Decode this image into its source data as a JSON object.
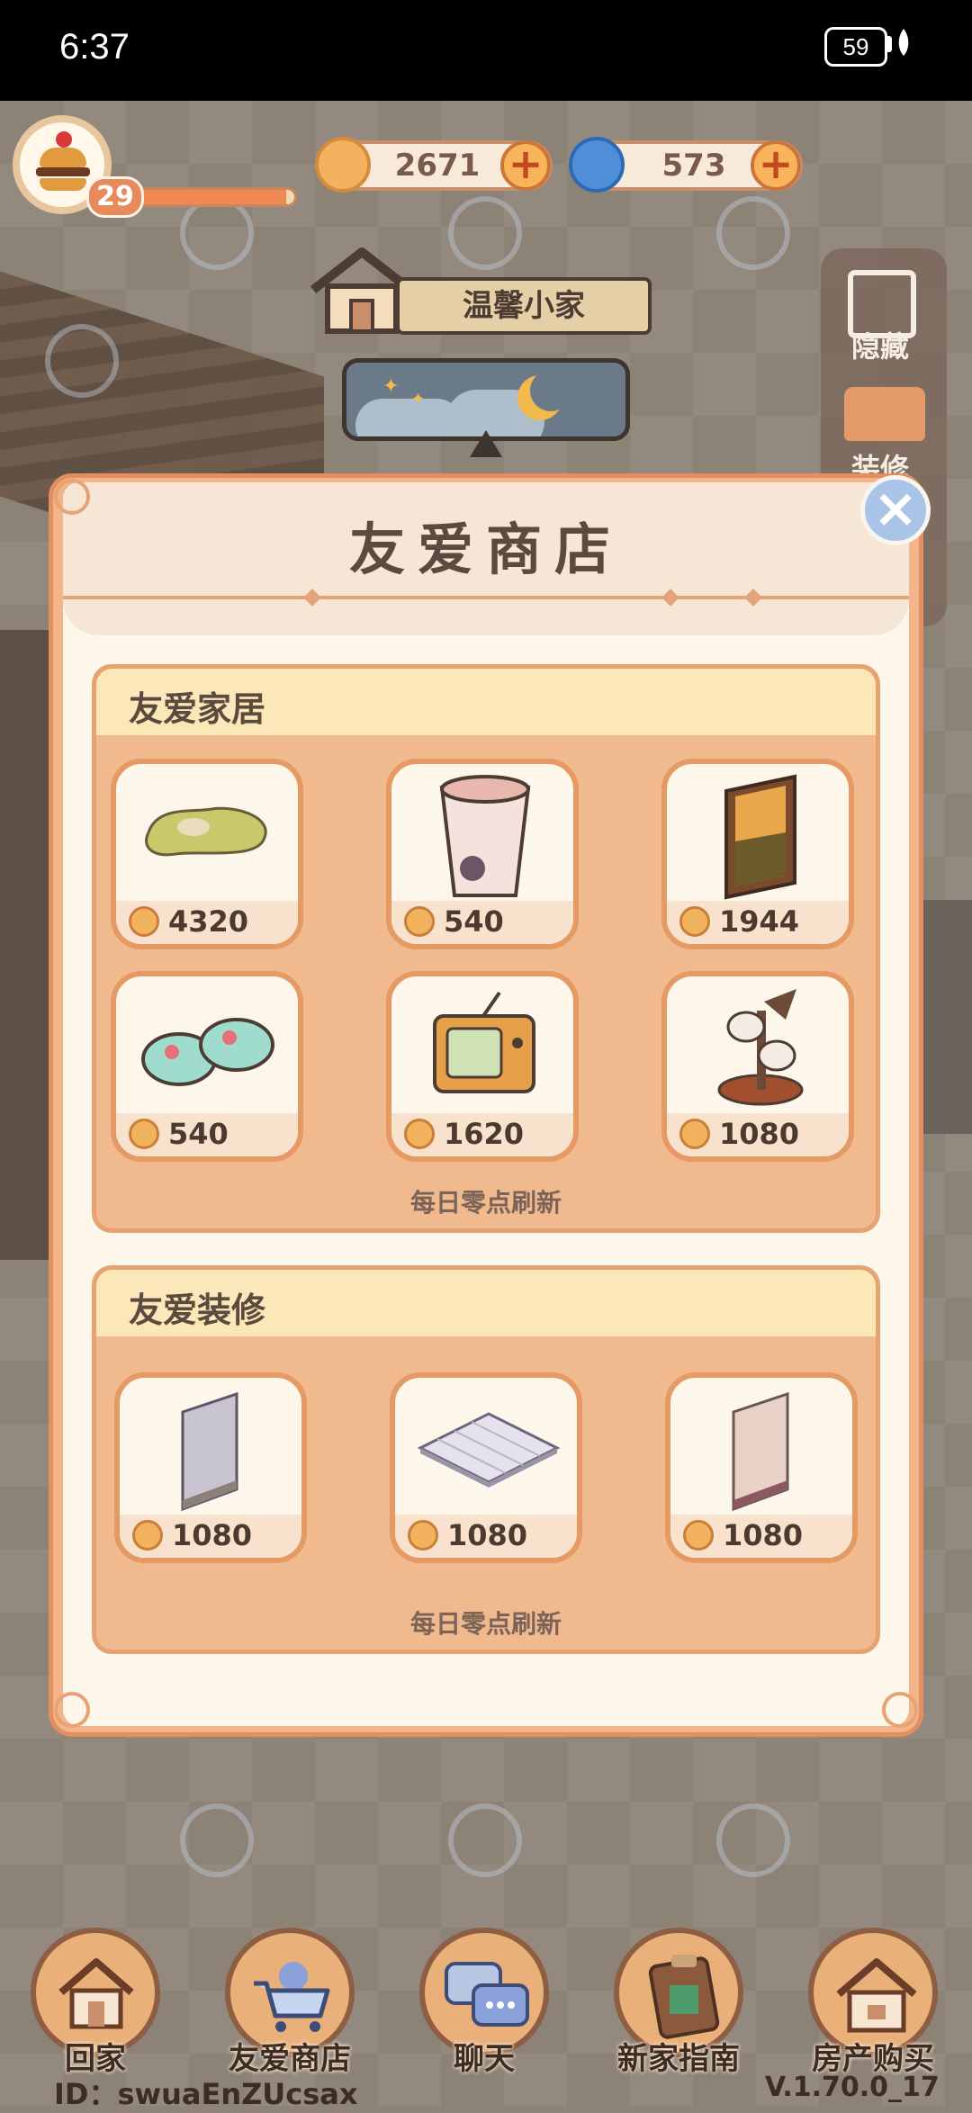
{
  "status_bar": {
    "time": "6:37",
    "battery": "59"
  },
  "hud": {
    "level": "29",
    "xp_fraction": 0.95,
    "coins": "2671",
    "gems": "573",
    "home_title": "温馨小家",
    "side_hide_label": "隐藏",
    "side_decor_label": "装修"
  },
  "shop": {
    "title": "友爱商店",
    "furniture": {
      "title": "友爱家居",
      "refresh_note": "每日零点刷新",
      "items": [
        {
          "icon": "rug-icon",
          "price": "4320"
        },
        {
          "icon": "cup-icon",
          "price": "540"
        },
        {
          "icon": "window-icon",
          "price": "1944"
        },
        {
          "icon": "slippers-icon",
          "price": "540"
        },
        {
          "icon": "tv-icon",
          "price": "1620"
        },
        {
          "icon": "cat-tree-icon",
          "price": "1080"
        }
      ]
    },
    "decor": {
      "title": "友爱装修",
      "refresh_note": "每日零点刷新",
      "items": [
        {
          "icon": "wallpaper-gray-icon",
          "price": "1080"
        },
        {
          "icon": "floor-tile-icon",
          "price": "1080"
        },
        {
          "icon": "wallpaper-pink-icon",
          "price": "1080"
        }
      ]
    }
  },
  "nav": {
    "home": "回家",
    "shop": "友爱商店",
    "chat": "聊天",
    "guide": "新家指南",
    "buy_house": "房产购买"
  },
  "footer": {
    "id": "ID：swuaEnZUcsax",
    "version": "V.1.70.0_17"
  },
  "colors": {
    "accent": "#f3b489",
    "coin": "#f2b25e",
    "gem": "#4f8fd8",
    "section": "#f1b98e"
  }
}
